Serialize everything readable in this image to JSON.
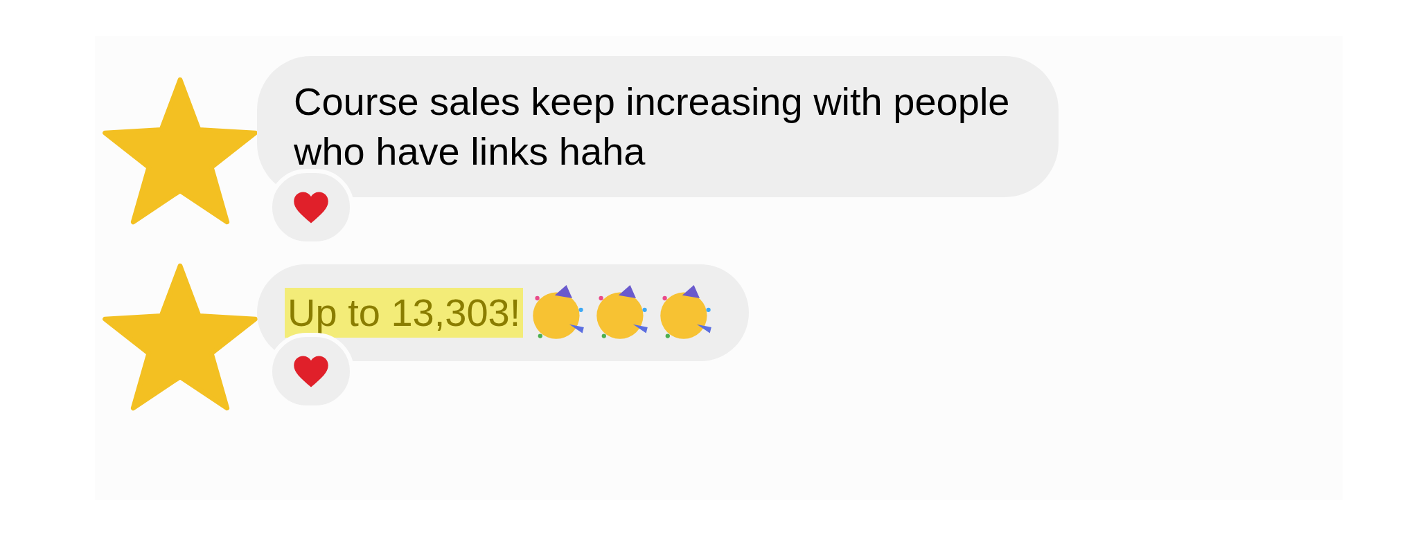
{
  "messages": [
    {
      "text": "Course sales keep increasing with people who have links haha",
      "highlighted": false,
      "kind": "plain",
      "reacted": true
    },
    {
      "text": "Up to 13,303!",
      "highlighted": true,
      "kind": "celebration",
      "reacted": true
    }
  ]
}
